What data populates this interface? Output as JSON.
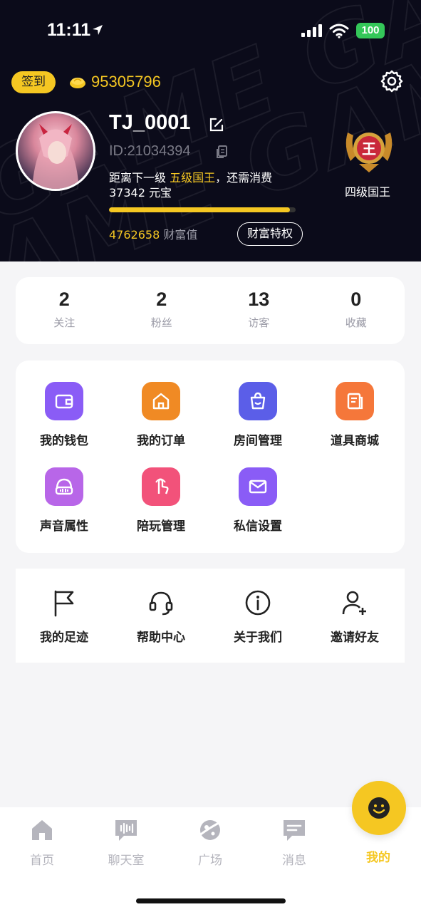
{
  "status_bar": {
    "time": "11:11",
    "battery": "100"
  },
  "header": {
    "signin_label": "签到",
    "coins": "95305796",
    "username": "TJ_0001",
    "user_id": "ID:21034394",
    "level_prefix": "距离下一级 ",
    "next_level": "五级国王",
    "level_suffix": "，还需消费 37342 元宝",
    "progress_fraction": 0.97,
    "wealth_value": "4762658",
    "wealth_label": " 财富值",
    "wealth_privilege_button": "财富特权",
    "current_level": "四级国王"
  },
  "stats": [
    {
      "value": "2",
      "label": "关注"
    },
    {
      "value": "2",
      "label": "粉丝"
    },
    {
      "value": "13",
      "label": "访客"
    },
    {
      "value": "0",
      "label": "收藏"
    }
  ],
  "features": [
    {
      "label": "我的钱包",
      "icon": "wallet-icon",
      "color": "#8a5cf6"
    },
    {
      "label": "我的订单",
      "icon": "order-icon",
      "color": "#f08a24"
    },
    {
      "label": "房间管理",
      "icon": "room-icon",
      "color": "#5b5ee8"
    },
    {
      "label": "道具商城",
      "icon": "store-icon",
      "color": "#f5773a"
    },
    {
      "label": "声音属性",
      "icon": "voice-icon",
      "color": "#b866e8"
    },
    {
      "label": "陪玩管理",
      "icon": "companion-icon",
      "color": "#f2527a"
    },
    {
      "label": "私信设置",
      "icon": "message-settings-icon",
      "color": "#8a5cf6"
    }
  ],
  "utilities": [
    {
      "label": "我的足迹",
      "icon": "flag-icon"
    },
    {
      "label": "帮助中心",
      "icon": "headset-icon"
    },
    {
      "label": "关于我们",
      "icon": "info-icon"
    },
    {
      "label": "邀请好友",
      "icon": "add-user-icon"
    }
  ],
  "tabs": [
    {
      "label": "首页",
      "icon": "home-icon"
    },
    {
      "label": "聊天室",
      "icon": "chat-room-icon"
    },
    {
      "label": "广场",
      "icon": "square-icon"
    },
    {
      "label": "消息",
      "icon": "message-icon"
    },
    {
      "label": "我的",
      "icon": "me-icon",
      "active": true
    }
  ]
}
